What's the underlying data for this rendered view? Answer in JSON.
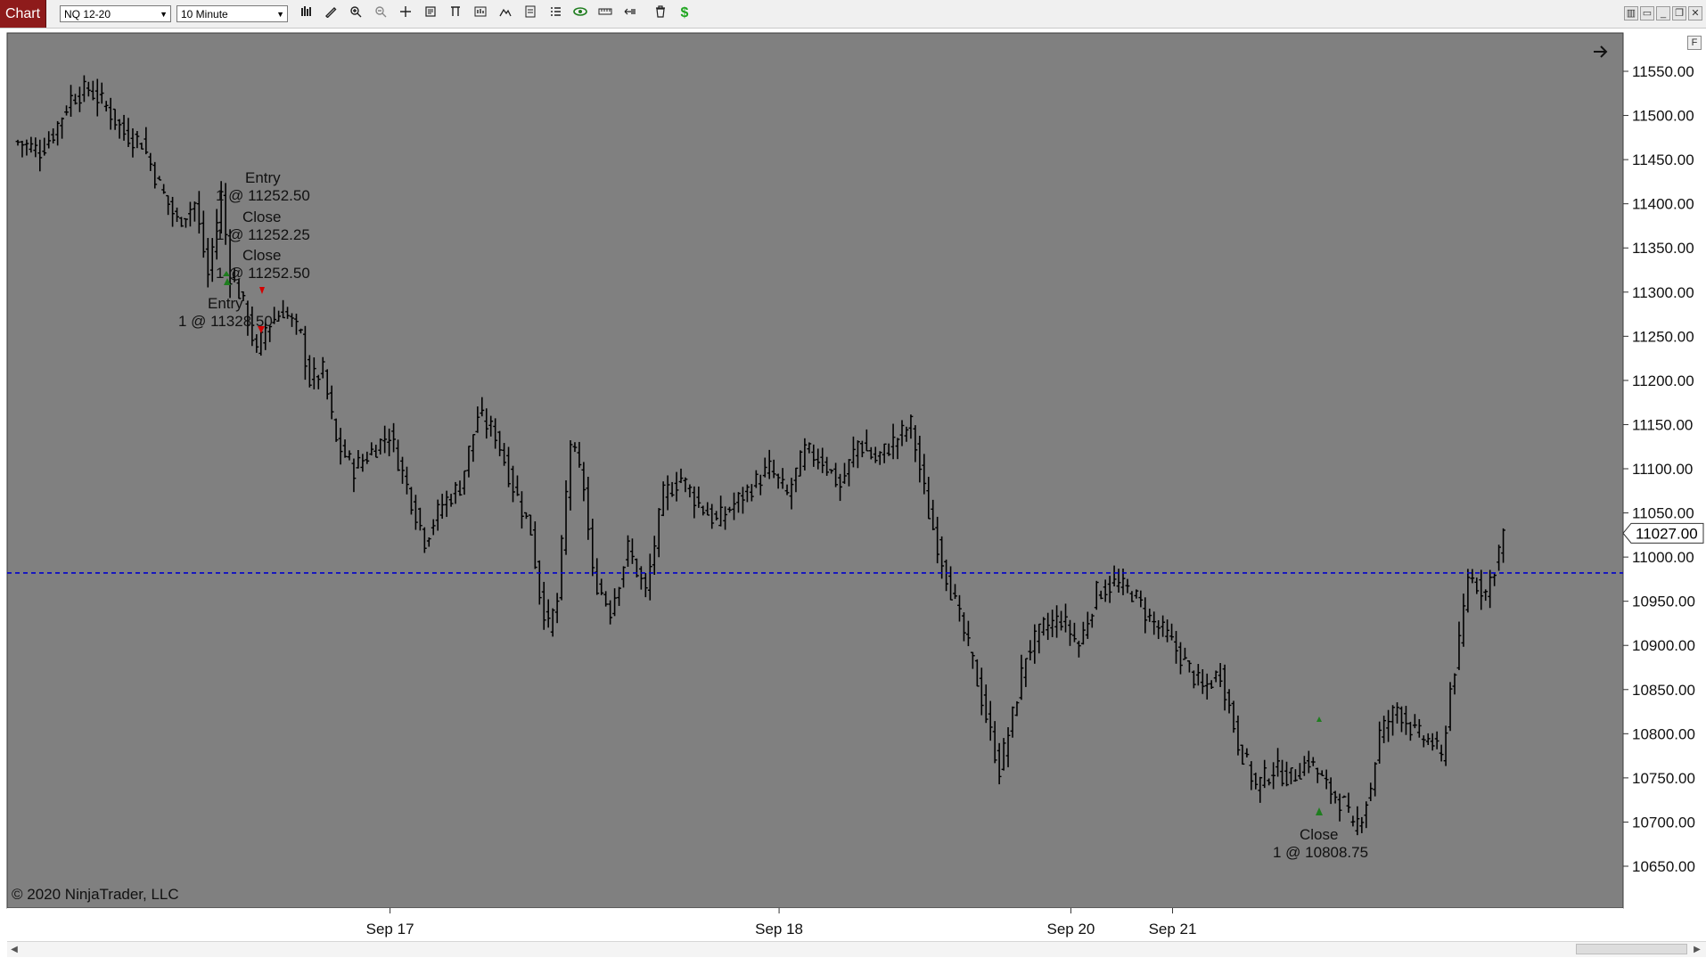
{
  "toolbar": {
    "chart_tab": "Chart",
    "instrument": "NQ 12-20",
    "interval": "10 Minute",
    "icons": [
      "bar-type-icon",
      "draw-tools-icon",
      "zoom-in-icon",
      "zoom-out-icon",
      "crosshair-icon",
      "data-box-icon",
      "indicators-icon",
      "strategies-icon",
      "templates-icon",
      "properties-icon",
      "object-list-icon",
      "show-trades-icon",
      "measure-icon",
      "pan-icon",
      "clear-icon",
      "dollar-icon"
    ],
    "dollar_color": "#1ea51e",
    "show_trades_color": "#1e7d1e"
  },
  "window_controls": [
    "tile-icon",
    "restore-icon",
    "minimize-icon",
    "maximize-icon",
    "close-icon"
  ],
  "chart": {
    "f_button": "F",
    "copyright": "© 2020 NinjaTrader, LLC",
    "background": "#808080",
    "price_axis_labels": [
      "11550.00",
      "11500.00",
      "11450.00",
      "11400.00",
      "11350.00",
      "11300.00",
      "11250.00",
      "11200.00",
      "11150.00",
      "11100.00",
      "11050.00",
      "11000.00",
      "10950.00",
      "10900.00",
      "10850.00",
      "10800.00",
      "10750.00",
      "10700.00",
      "10650.00"
    ],
    "last_price": "11027.00",
    "date_labels": [
      "Sep 17",
      "Sep 18",
      "Sep 20",
      "Sep 21"
    ],
    "trade_labels": {
      "entry1": "Entry",
      "entry1_detail": "1 @ 11252.50",
      "close1": "Close",
      "close1_detail": "1 @ 11252.25",
      "close2": "Close",
      "close2_detail": "1 @ 11252.50",
      "entry2": "Entry",
      "entry2_detail": "1 @ 11328.50",
      "close3": "Close",
      "close3_detail": "1 @ 10808.75"
    },
    "line_color": "#0000cc",
    "buy_color": "#1e7d1e",
    "sell_color": "#d40000"
  },
  "chart_data": {
    "type": "line",
    "instrument": "NQ 12-20",
    "interval": "10 Minute",
    "ylim": [
      10625,
      11575
    ],
    "y_ticks": [
      11550,
      11500,
      11450,
      11400,
      11350,
      11300,
      11250,
      11200,
      11150,
      11100,
      11050,
      11000,
      10950,
      10900,
      10850,
      10800,
      10750,
      10700,
      10650
    ],
    "x_tick_labels": [
      "Sep 17",
      "Sep 18",
      "Sep 20",
      "Sep 21"
    ],
    "x_tick_bars": [
      60,
      148,
      214,
      237
    ],
    "last_price": 11027.0,
    "horizontal_line": 10982,
    "bars": 336,
    "price_path": [
      [
        0,
        11470
      ],
      [
        5,
        11460
      ],
      [
        8,
        11480
      ],
      [
        12,
        11520
      ],
      [
        16,
        11530
      ],
      [
        20,
        11510
      ],
      [
        24,
        11480
      ],
      [
        28,
        11470
      ],
      [
        32,
        11420
      ],
      [
        36,
        11380
      ],
      [
        40,
        11400
      ],
      [
        43,
        11320
      ],
      [
        46,
        11410
      ],
      [
        48,
        11320
      ],
      [
        50,
        11300
      ],
      [
        52,
        11270
      ],
      [
        54,
        11230
      ],
      [
        56,
        11260
      ],
      [
        60,
        11280
      ],
      [
        64,
        11250
      ],
      [
        66,
        11200
      ],
      [
        69,
        11210
      ],
      [
        72,
        11130
      ],
      [
        76,
        11100
      ],
      [
        80,
        11120
      ],
      [
        84,
        11140
      ],
      [
        88,
        11080
      ],
      [
        92,
        11020
      ],
      [
        96,
        11060
      ],
      [
        100,
        11080
      ],
      [
        104,
        11160
      ],
      [
        108,
        11140
      ],
      [
        112,
        11080
      ],
      [
        116,
        11030
      ],
      [
        118,
        10960
      ],
      [
        120,
        10920
      ],
      [
        122,
        10950
      ],
      [
        125,
        11130
      ],
      [
        128,
        11080
      ],
      [
        130,
        10980
      ],
      [
        134,
        10940
      ],
      [
        138,
        11010
      ],
      [
        142,
        10960
      ],
      [
        146,
        11070
      ],
      [
        150,
        11090
      ],
      [
        154,
        11060
      ],
      [
        158,
        11040
      ],
      [
        162,
        11060
      ],
      [
        166,
        11080
      ],
      [
        170,
        11100
      ],
      [
        174,
        11070
      ],
      [
        178,
        11120
      ],
      [
        182,
        11110
      ],
      [
        186,
        11080
      ],
      [
        190,
        11130
      ],
      [
        194,
        11110
      ],
      [
        198,
        11130
      ],
      [
        202,
        11150
      ],
      [
        206,
        11050
      ],
      [
        210,
        10980
      ],
      [
        213,
        10930
      ],
      [
        216,
        10880
      ],
      [
        219,
        10820
      ],
      [
        222,
        10760
      ],
      [
        225,
        10820
      ],
      [
        228,
        10890
      ],
      [
        232,
        10920
      ],
      [
        236,
        10930
      ],
      [
        240,
        10900
      ],
      [
        244,
        10960
      ],
      [
        248,
        10970
      ],
      [
        252,
        10960
      ],
      [
        256,
        10930
      ],
      [
        260,
        10910
      ],
      [
        264,
        10880
      ],
      [
        268,
        10850
      ],
      [
        272,
        10870
      ],
      [
        276,
        10790
      ],
      [
        280,
        10740
      ],
      [
        284,
        10760
      ],
      [
        288,
        10750
      ],
      [
        292,
        10770
      ],
      [
        296,
        10740
      ],
      [
        300,
        10720
      ],
      [
        302,
        10690
      ],
      [
        304,
        10710
      ],
      [
        306,
        10740
      ],
      [
        308,
        10800
      ],
      [
        312,
        10830
      ],
      [
        316,
        10800
      ],
      [
        320,
        10790
      ],
      [
        322,
        10770
      ],
      [
        324,
        10850
      ],
      [
        326,
        10900
      ],
      [
        328,
        10980
      ],
      [
        330,
        10970
      ],
      [
        332,
        10960
      ],
      [
        334,
        10990
      ],
      [
        336,
        11027
      ]
    ],
    "trades": [
      {
        "label": "Entry",
        "detail": "1 @ 11252.50"
      },
      {
        "label": "Close",
        "detail": "1 @ 11252.25"
      },
      {
        "label": "Close",
        "detail": "1 @ 11252.50"
      },
      {
        "label": "Entry",
        "detail": "1 @ 11328.50"
      },
      {
        "label": "Close",
        "detail": "1 @ 10808.75"
      }
    ],
    "grid": false
  }
}
